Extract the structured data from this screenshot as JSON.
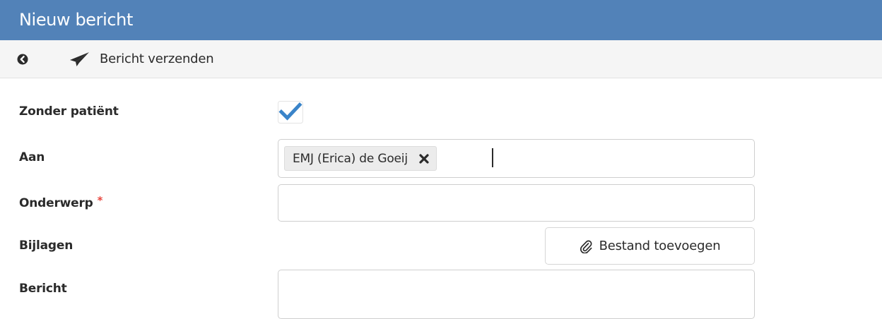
{
  "window": {
    "title": "Nieuw bericht"
  },
  "toolbar": {
    "back_icon": "circle-arrow-left-icon",
    "send_icon": "paper-plane-icon",
    "send_label": "Bericht verzenden"
  },
  "form": {
    "zonder_patient": {
      "label": "Zonder patiënt",
      "checked": true
    },
    "aan": {
      "label": "Aan",
      "recipients": [
        {
          "name": "EMJ (Erica) de Goeij",
          "remove_icon": "close-icon"
        }
      ]
    },
    "onderwerp": {
      "label": "Onderwerp",
      "required_marker": "*",
      "value": "",
      "placeholder": ""
    },
    "bijlagen": {
      "label": "Bijlagen",
      "add_label": "Bestand toevoegen",
      "add_icon": "paperclip-icon"
    },
    "bericht": {
      "label": "Bericht",
      "value": ""
    }
  },
  "colors": {
    "titlebar": "#5282b8",
    "checkmark": "#3a84c9",
    "required": "#e8463e"
  }
}
